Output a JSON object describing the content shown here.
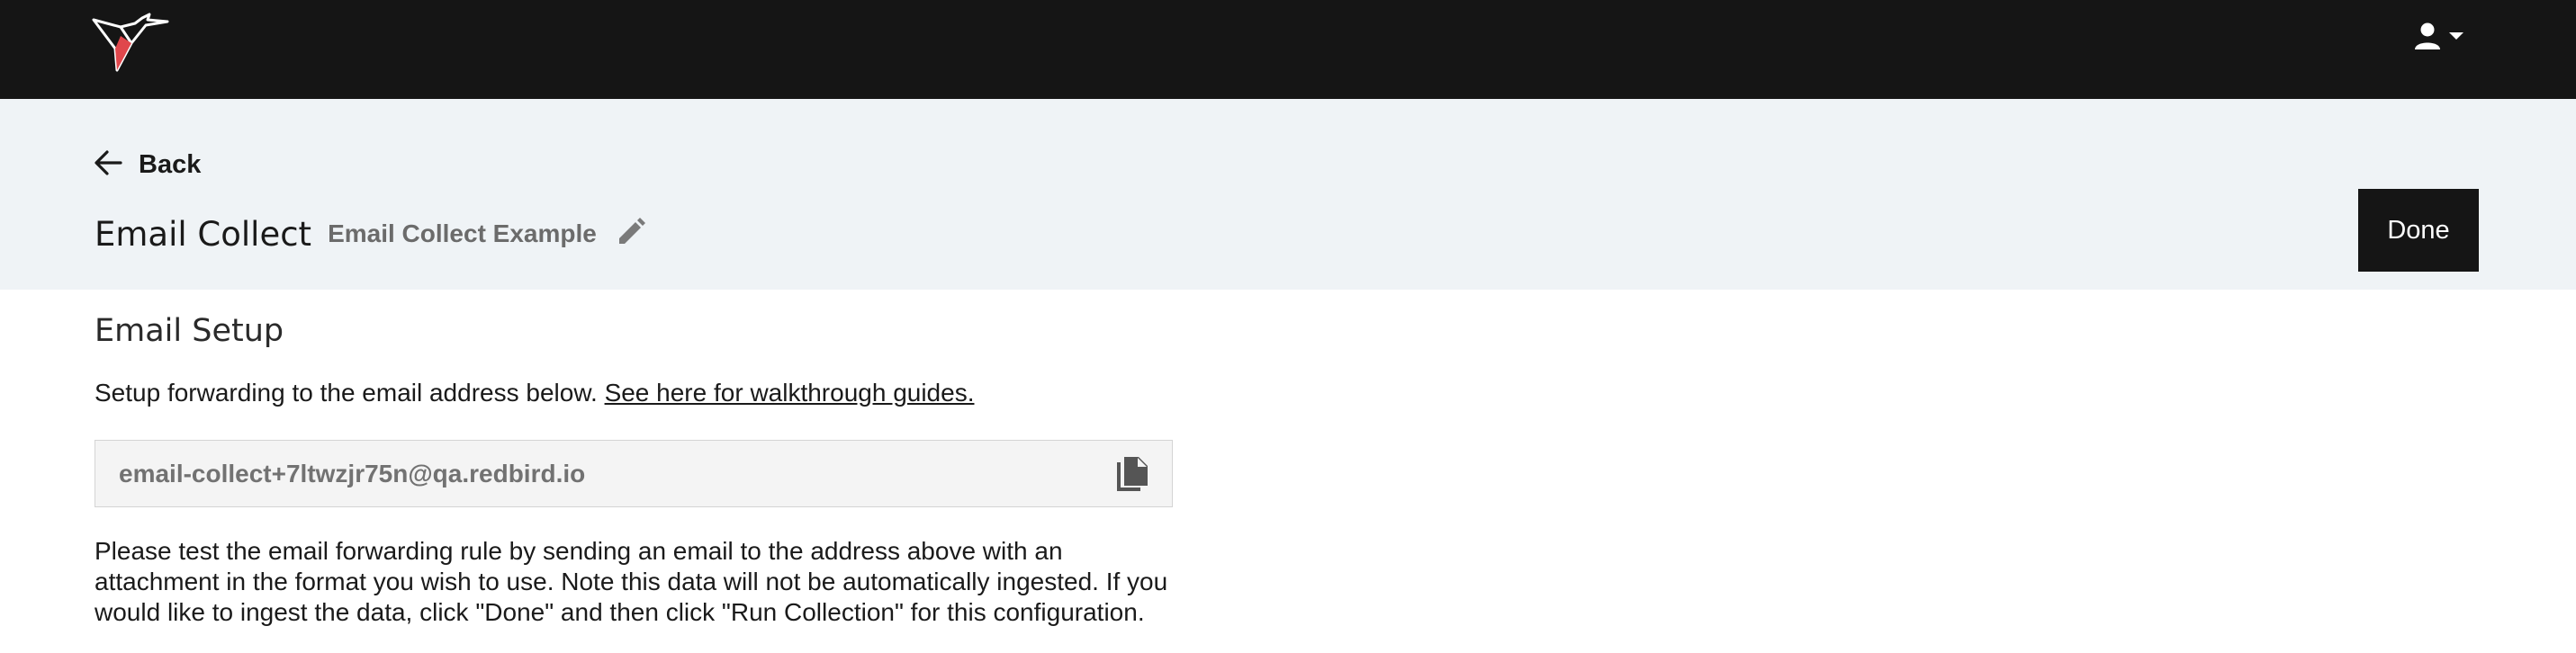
{
  "topbar": {
    "logo_icon": "hummingbird-logo-icon",
    "user_icon": "user-icon",
    "user_caret_icon": "caret-down-icon",
    "brand_accent": "#e0474c"
  },
  "header": {
    "back_label": "Back",
    "back_icon": "arrow-left-icon",
    "title": "Email Collect",
    "config_name": "Email Collect Example",
    "edit_icon": "pencil-icon",
    "done_label": "Done"
  },
  "setup": {
    "section_title": "Email Setup",
    "instruction_text": "Setup forwarding to the email address below. ",
    "guide_link": "See here for walkthrough guides.",
    "email_address": "email-collect+7ltwzjr75n@qa.redbird.io",
    "copy_icon": "copy-icon",
    "note": "Please test the email forwarding rule by sending an email to the address above with an attachment in the format you wish to use. Note this data will not be automatically ingested. If you would like to ingest the data, click \"Done\" and then click \"Run Collection\" for this configuration."
  }
}
